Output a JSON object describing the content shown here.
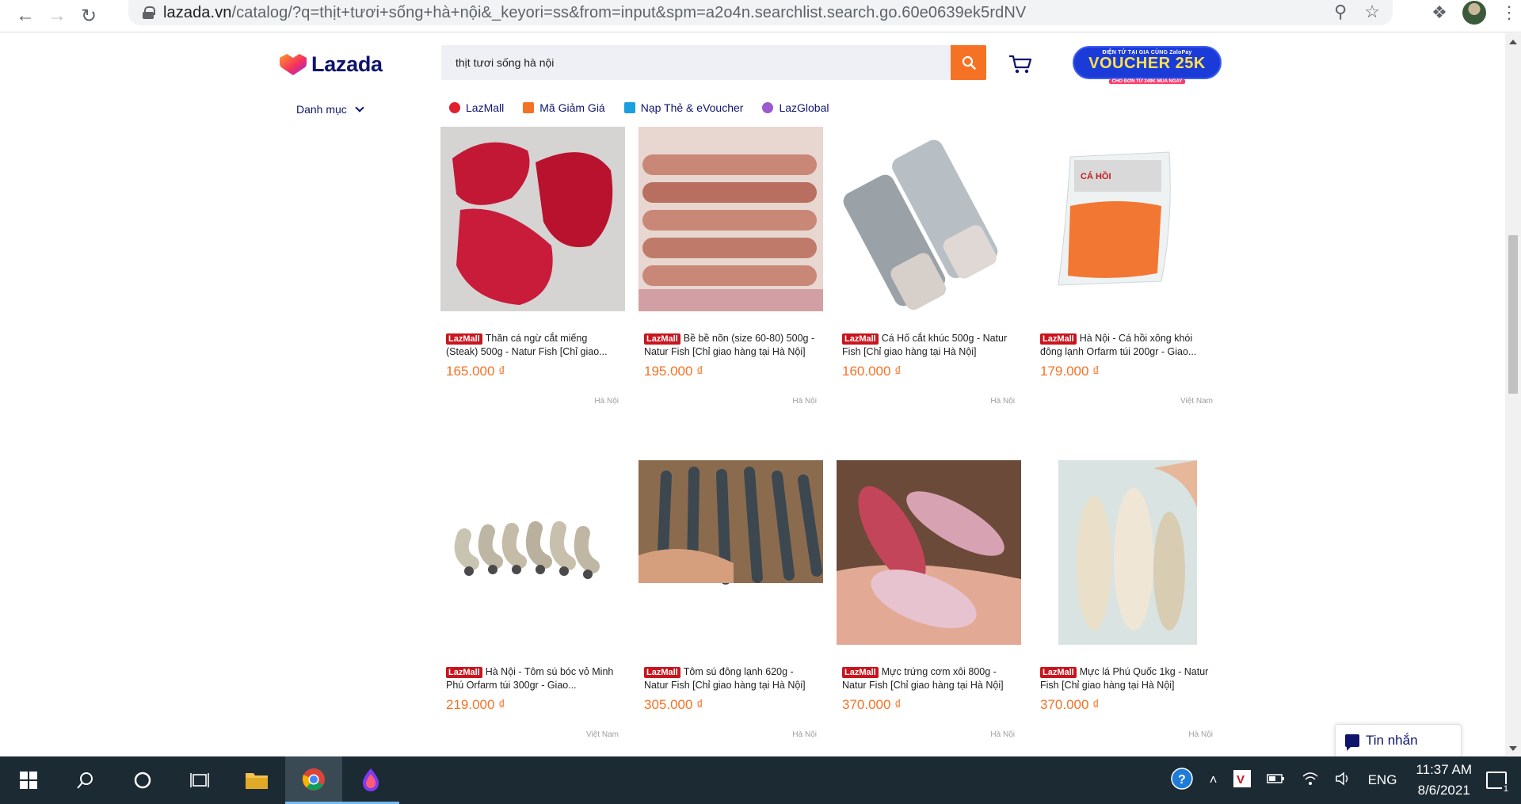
{
  "browser": {
    "url_main": "lazada.vn",
    "url_rest": "/catalog/?q=thịt+tươi+sống+hà+nội&_keyori=ss&from=input&spm=a2o4n.searchlist.search.go.60e0639ek5rdNV"
  },
  "header": {
    "logo_text": "Lazada",
    "search_value": "thịt tươi sống hà nội",
    "voucher_top": "ĐIỆN TỬ TẠI GIA CÙNG ZaloPay",
    "voucher_main": "VOUCHER 25K",
    "voucher_bottom": "CHO ĐƠN TỪ 249K   MUA NGAY",
    "category_label": "Danh mục",
    "subnav": [
      {
        "label": "LazMall",
        "color": "#e0202e"
      },
      {
        "label": "Mã Giảm Giá",
        "color": "#f57224"
      },
      {
        "label": "Nạp Thẻ & eVoucher",
        "color": "#1a9fe0"
      },
      {
        "label": "LazGlobal",
        "color": "#9b59d0"
      }
    ]
  },
  "badge_label": "LazMall",
  "products": [
    {
      "title": "Thăn cá ngừ cắt miếng (Steak) 500g - Natur Fish [Chỉ giao...",
      "price": "165.000 ₫",
      "location": "Hà Nội"
    },
    {
      "title": "Bề bề nõn (size 60-80) 500g - Natur Fish [Chỉ giao hàng tại Hà Nội]",
      "price": "195.000 ₫",
      "location": "Hà Nội"
    },
    {
      "title": "Cá Hố cắt khúc 500g - Natur Fish [Chỉ giao hàng tại Hà Nội]",
      "price": "160.000 ₫",
      "location": "Hà Nội"
    },
    {
      "title": "Hà Nội - Cá hồi xông khói đông lạnh Orfarm túi 200gr - Giao...",
      "price": "179.000 ₫",
      "location": "Việt Nam"
    },
    {
      "title": "Hà Nội - Tôm sú bóc vỏ Minh Phú Orfarm túi 300gr - Giao...",
      "price": "219.000 ₫",
      "location": "Việt Nam"
    },
    {
      "title": "Tôm sú đông lạnh 620g - Natur Fish [Chỉ giao hàng tại Hà Nội]",
      "price": "305.000 ₫",
      "location": "Hà Nội"
    },
    {
      "title": "Mực trứng cơm xôi 800g - Natur Fish [Chỉ giao hàng tại Hà Nội]",
      "price": "370.000 ₫",
      "location": "Hà Nội"
    },
    {
      "title": "Mực lá Phú Quốc 1kg - Natur Fish [Chỉ giao hàng tại Hà Nội]",
      "price": "370.000 ₫",
      "location": "Hà Nội"
    }
  ],
  "chat_label": "Tin nhắn",
  "taskbar": {
    "lang": "ENG",
    "time": "11:37 AM",
    "date": "8/6/2021",
    "notif_count": "1"
  },
  "colors": {
    "accent": "#f57224",
    "brand_navy": "#0f146d",
    "lazmall_red": "#c9151e"
  }
}
